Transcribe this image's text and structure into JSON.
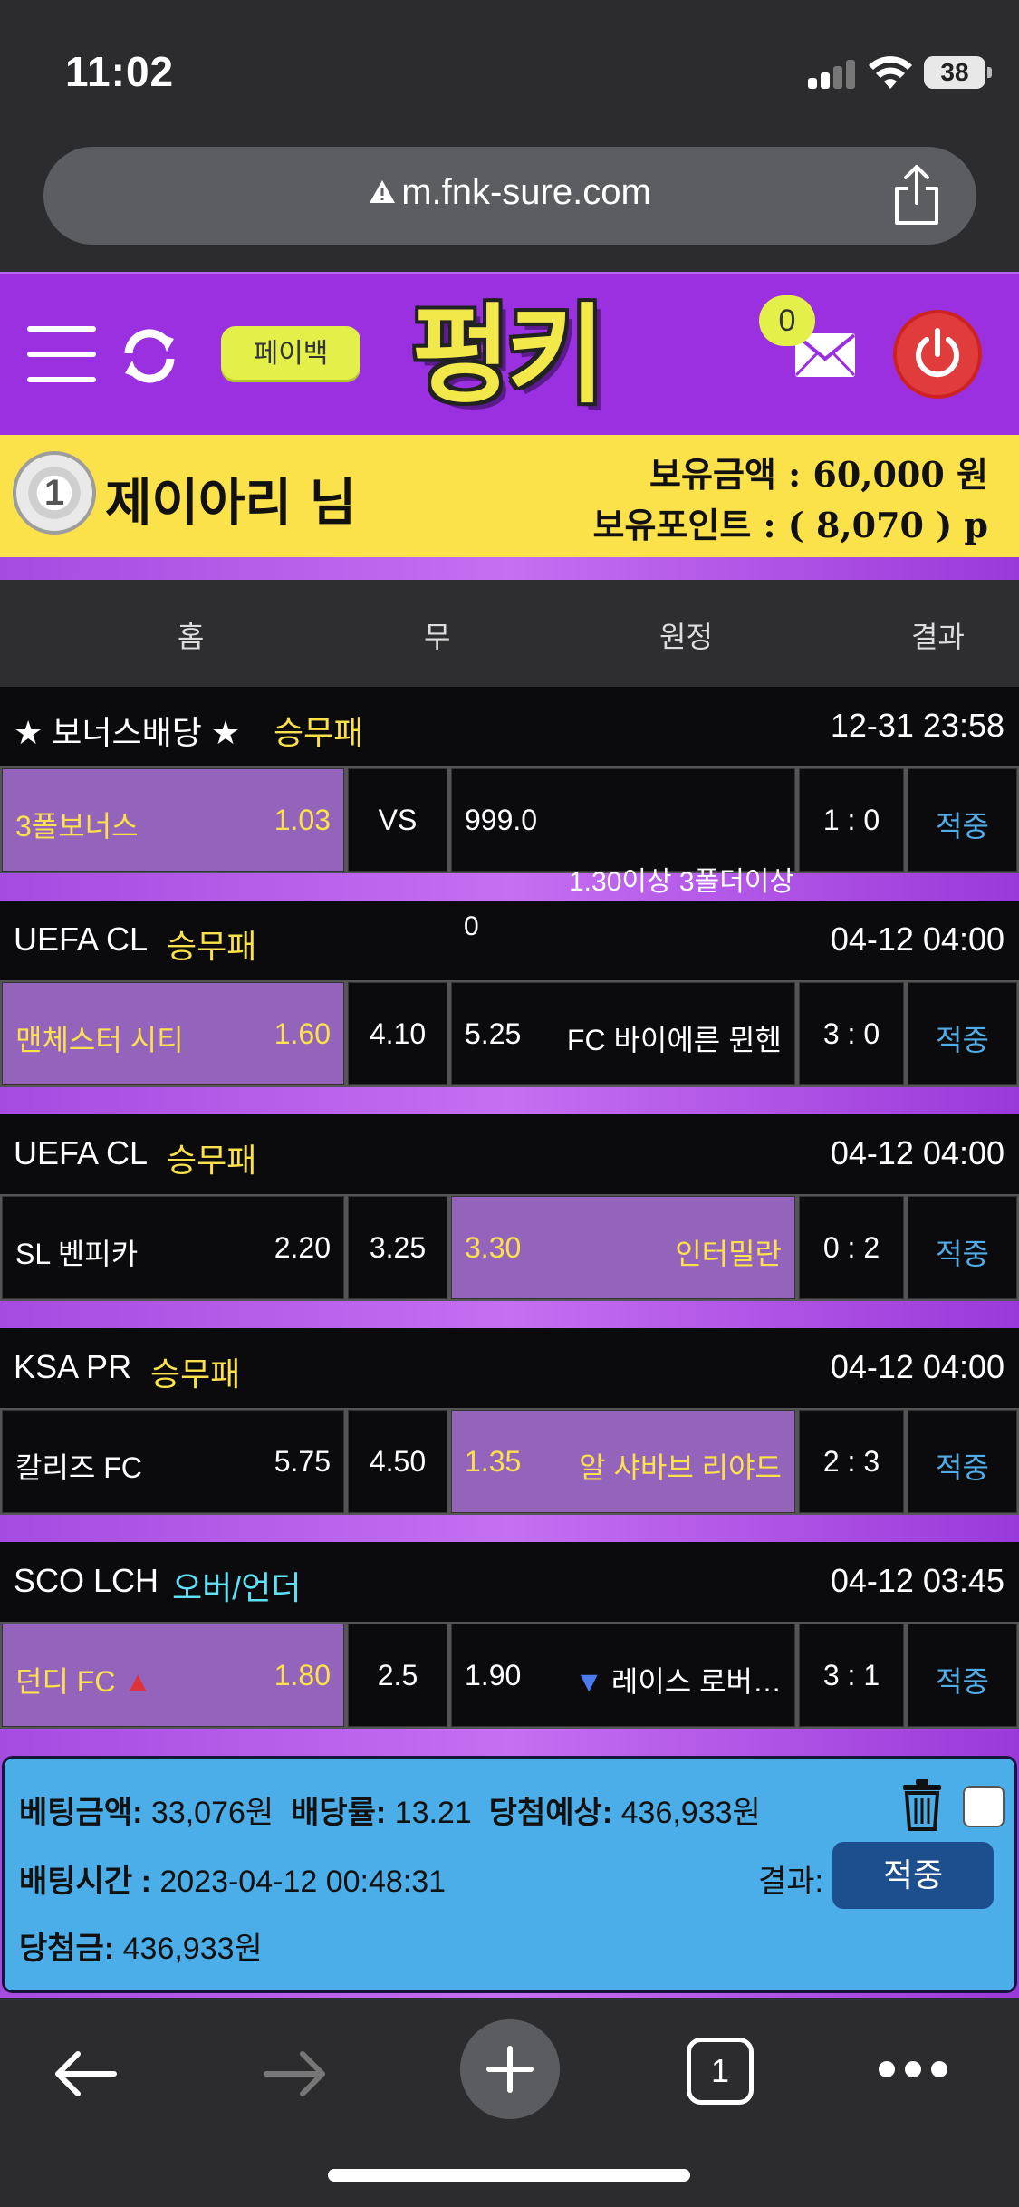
{
  "status_bar": {
    "time": "11:02",
    "battery": "38"
  },
  "browser": {
    "url": "m.fnk-sure.com",
    "tab_count": "1"
  },
  "header": {
    "payback_label": "페이백",
    "logo_text": "펑키",
    "mail_count": "0"
  },
  "user": {
    "level": "1",
    "name": "제이아리 님",
    "balance_line": "보유금액 : 60,000 원",
    "points_line": "보유포인트 : ( 8,070 ) p"
  },
  "columns": {
    "home": "홈",
    "draw": "무",
    "away": "원정",
    "result": "결과"
  },
  "games": [
    {
      "league": "★ 보너스배당 ★",
      "type": "승무패",
      "datetime": "12-31 23:58",
      "home_team": "3폴보너스",
      "home_odds": "1.03",
      "draw": "VS",
      "away_odds": "999.0",
      "away_team": "",
      "score": "1 : 0",
      "result": "적중",
      "selected": "home"
    },
    {
      "league": "UEFA CL",
      "type": "승무패",
      "datetime": "04-12 04:00",
      "home_team": "맨체스터 시티",
      "home_odds": "1.60",
      "draw": "4.10",
      "away_odds": "5.25",
      "away_team": "FC 바이에른 뮌헨",
      "score": "3 : 0",
      "result": "적중",
      "selected": "home"
    },
    {
      "league": "UEFA CL",
      "type": "승무패",
      "datetime": "04-12 04:00",
      "home_team": "SL 벤피카",
      "home_odds": "2.20",
      "draw": "3.25",
      "away_odds": "3.30",
      "away_team": "인터밀란",
      "score": "0 : 2",
      "result": "적중",
      "selected": "away"
    },
    {
      "league": "KSA PR",
      "type": "승무패",
      "datetime": "04-12 04:00",
      "home_team": "칼리즈 FC",
      "home_odds": "5.75",
      "draw": "4.50",
      "away_odds": "1.35",
      "away_team": "알 샤바브 리야드",
      "score": "2 : 3",
      "result": "적중",
      "selected": "away"
    },
    {
      "league": "SCO LCH",
      "type": "오버/언더",
      "datetime": "04-12 03:45",
      "home_team": "던디 FC",
      "home_odds": "1.80",
      "draw": "2.5",
      "away_odds": "1.90",
      "away_team": "레이스 로버…",
      "score": "3 : 1",
      "result": "적중",
      "selected": "home"
    }
  ],
  "overlay": {
    "note": "1.30이상 3폴더이상",
    "zero": "0"
  },
  "bet": {
    "amount_label": "베팅금액:",
    "amount": "33,076원",
    "odds_label": "배당률:",
    "odds": "13.21",
    "expected_label": "당첨예상:",
    "expected": "436,933원",
    "time_label": "배팅시간 :",
    "time": "2023-04-12 00:48:31",
    "result_label": "결과:",
    "result": "적중",
    "win_label": "당첨금:",
    "win": "436,933원"
  },
  "colors": {
    "header_purple": "#9a30e0",
    "user_yellow": "#fbe14a",
    "selected_cell": "#9464bd",
    "result_blue": "#4faee8",
    "bet_box": "#4caee8"
  }
}
